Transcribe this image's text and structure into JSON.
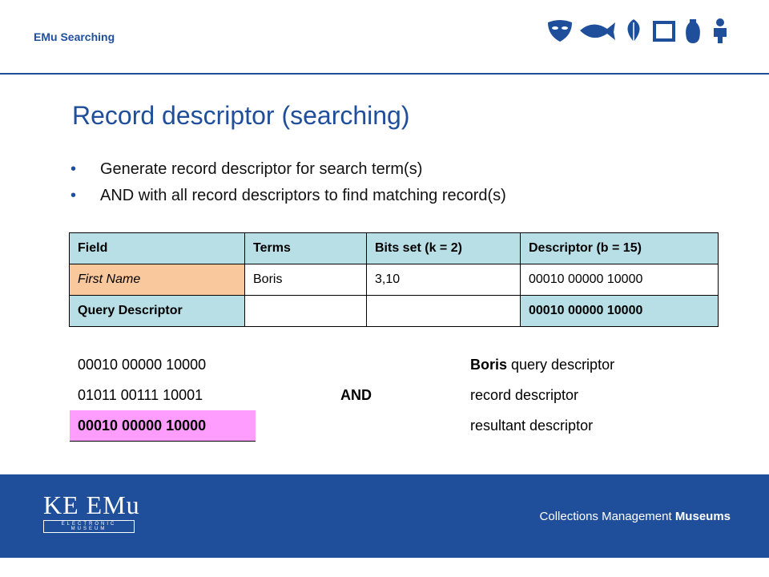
{
  "header": {
    "label": "EMu Searching"
  },
  "slide": {
    "title": "Record descriptor (searching)",
    "bullets": [
      "Generate record descriptor for search term(s)",
      "AND with all record descriptors to find matching record(s)"
    ]
  },
  "table": {
    "headers": [
      "Field",
      "Terms",
      "Bits set (k = 2)",
      "Descriptor (b = 15)"
    ],
    "rows": [
      [
        "First Name",
        "Boris",
        "3,10",
        "00010 00000 10000"
      ],
      [
        "Query Descriptor",
        "",
        "",
        "00010 00000 10000"
      ]
    ]
  },
  "calculation": {
    "line1": {
      "value": "00010 00000 10000",
      "note_bold": "Boris",
      "note_rest": " query descriptor"
    },
    "line2": {
      "value": "01011 00111 10001",
      "operator": "AND",
      "note": "record descriptor"
    },
    "line3": {
      "value": "00010 00000 10000",
      "note": "resultant descriptor"
    }
  },
  "footer": {
    "logo_main": "KE EMu",
    "logo_sub": "ELECTRONIC MUSEUM",
    "tagline_plain": "Collections Management ",
    "tagline_bold": "Museums"
  },
  "colors": {
    "brand_blue": "#1f4e9b",
    "header_cell": "#b8dfe6",
    "first_name_cell": "#f9c89c",
    "result_highlight": "#ff9dff"
  },
  "icons": [
    "mask-icon",
    "fish-icon",
    "leaf-icon",
    "frame-icon",
    "vase-icon",
    "figure-icon"
  ]
}
